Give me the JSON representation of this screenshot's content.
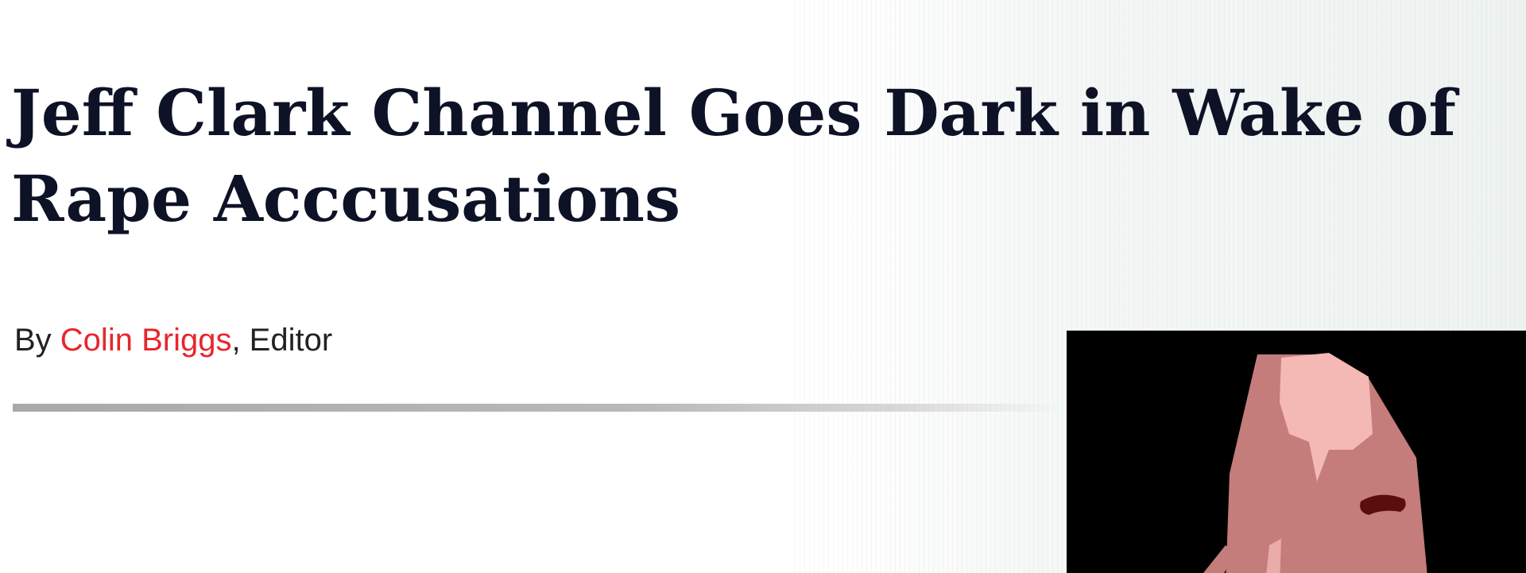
{
  "article": {
    "headline_line1": "Jeff Clark Channel Goes Dark in Wake of",
    "headline_line2": "Rape Acccusations",
    "byline": {
      "prefix": "By ",
      "author": "Colin Briggs",
      "suffix": ", Editor"
    },
    "image": {
      "subject": "portrait-photo",
      "colors": {
        "background": "#000000",
        "skin": "#c47d7a",
        "hair": "#f4b8b5",
        "eye": "#5a0e0e"
      }
    }
  },
  "colors": {
    "headline": "#0e1226",
    "author_link": "#e8262d",
    "byline_text": "#222222",
    "divider": "#aaaaaa"
  }
}
